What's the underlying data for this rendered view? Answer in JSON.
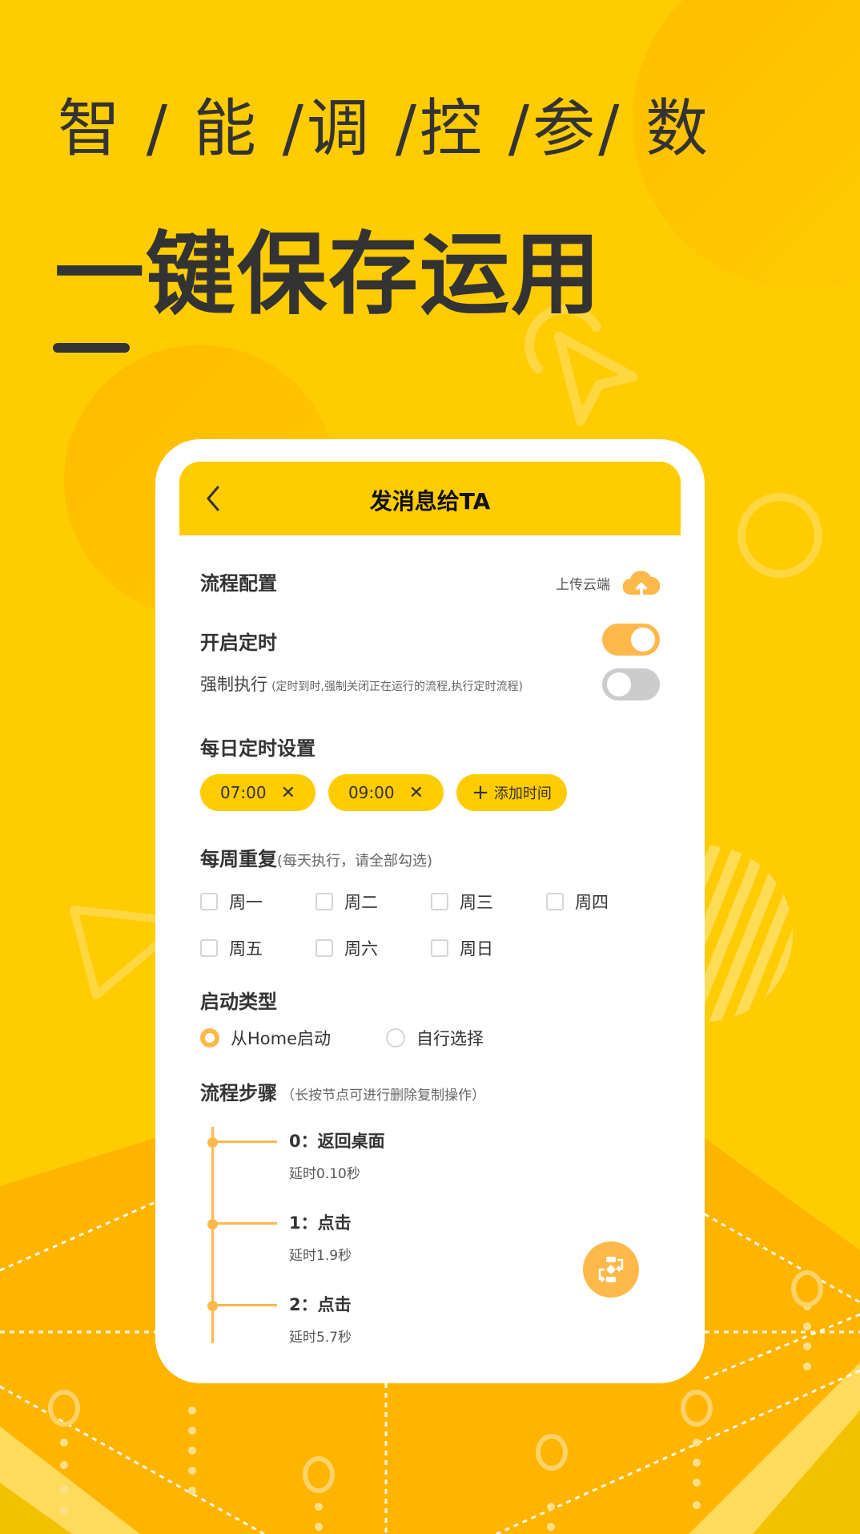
{
  "promo": {
    "headline_1": "智 / 能 /调 /控 /参/ 数",
    "headline_2": "一键保存运用"
  },
  "colors": {
    "background": "#ffcc02",
    "accent_yellow": "#ffcc02",
    "accent_orange": "#ffb84a",
    "text_dark": "#333333",
    "toggle_off": "#cccccc"
  },
  "appbar": {
    "back_icon": "chevron-left-icon",
    "title": "发消息给TA"
  },
  "flow_config": {
    "label": "流程配置",
    "upload_label": "上传云端",
    "upload_icon": "cloud-upload-icon"
  },
  "timer": {
    "label": "开启定时",
    "enabled": true
  },
  "force_exec": {
    "label": "强制执行",
    "hint": "(定时到时,强制关闭正在运行的流程,执行定时流程)",
    "enabled": false
  },
  "daily": {
    "label": "每日定时设置",
    "times": [
      {
        "value": "07:00",
        "remove": "✕"
      },
      {
        "value": "09:00",
        "remove": "✕"
      }
    ],
    "add_icon": "+",
    "add_label": "添加时间"
  },
  "weekly": {
    "label": "每周重复",
    "hint": "(每天执行，请全部勾选)",
    "days": [
      {
        "label": "周一",
        "checked": false
      },
      {
        "label": "周二",
        "checked": false
      },
      {
        "label": "周三",
        "checked": false
      },
      {
        "label": "周四",
        "checked": false
      },
      {
        "label": "周五",
        "checked": false
      },
      {
        "label": "周六",
        "checked": false
      },
      {
        "label": "周日",
        "checked": false
      }
    ]
  },
  "launch_type": {
    "label": "启动类型",
    "options": [
      {
        "label": "从Home启动",
        "selected": true
      },
      {
        "label": "自行选择",
        "selected": false
      }
    ]
  },
  "steps": {
    "label": "流程步骤",
    "hint": "（长按节点可进行删除复制操作）",
    "items": [
      {
        "name": "0：返回桌面",
        "delay": "延时0.10秒"
      },
      {
        "name": "1：点击",
        "delay": "延时1.9秒"
      },
      {
        "name": "2：点击",
        "delay": "延时5.7秒"
      }
    ],
    "fab_icon": "flowchart-icon"
  }
}
